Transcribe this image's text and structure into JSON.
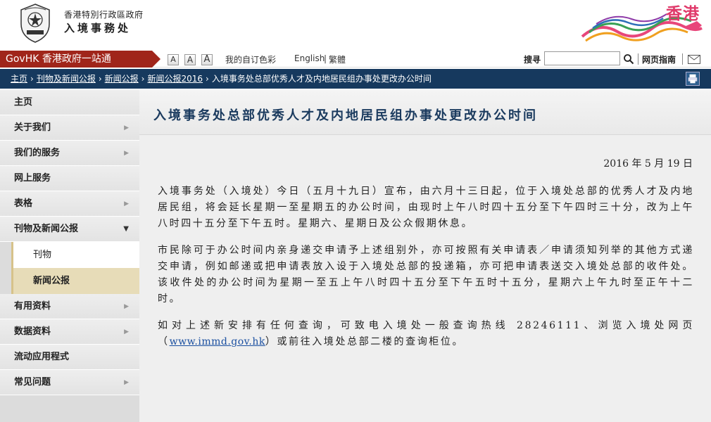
{
  "header": {
    "dept_top": "香港特別行政區政府",
    "dept_name": "入境事務处",
    "brand": "香港"
  },
  "topbar": {
    "govhk": "GovHK 香港政府一站通",
    "font_small": "A",
    "font_medium": "A",
    "font_large": "A",
    "my_theme": "我的自订色彩",
    "lang_en": "English",
    "lang_sep": "|",
    "lang_tc": "繁體",
    "search_label": "搜寻",
    "search_value": "",
    "sitemap": "网页指南"
  },
  "breadcrumb": {
    "items": [
      "主页",
      "刊物及新闻公报",
      "新闻公报",
      "新闻公报2016"
    ],
    "separator": "›",
    "current": "入境事务处总部优秀人才及内地居民组办事处更改办公时间"
  },
  "sidebar": {
    "items": [
      {
        "label": "主页",
        "arrow": ""
      },
      {
        "label": "关于我们",
        "arrow": "▶"
      },
      {
        "label": "我们的服务",
        "arrow": "▶"
      },
      {
        "label": "网上服务",
        "arrow": ""
      },
      {
        "label": "表格",
        "arrow": "▶"
      },
      {
        "label": "刊物及新闻公报",
        "arrow": "▼"
      }
    ],
    "sub_items": [
      {
        "label": "刊物"
      },
      {
        "label": "新闻公报"
      }
    ],
    "items_after": [
      {
        "label": "有用资料",
        "arrow": "▶"
      },
      {
        "label": "数据资料",
        "arrow": "▶"
      },
      {
        "label": "流动应用程式",
        "arrow": ""
      },
      {
        "label": "常见问题",
        "arrow": "▶"
      }
    ]
  },
  "main": {
    "title": "入境事务处总部优秀人才及内地居民组办事处更改办公时间",
    "date": "2016 年 5 月 19 日",
    "para1": "入境事务处（入境处）今日（五月十九日）宣布，由六月十三日起，位于入境处总部的优秀人才及内地居民组，将会延长星期一至星期五的办公时间，由现时上午八时四十五分至下午四时三十分，改为上午八时四十五分至下午五时。星期六、星期日及公众假期休息。",
    "para2": "市民除可于办公时间内亲身递交申请予上述组别外，亦可按照有关申请表／申请须知列举的其他方式递交申请，例如邮递或把申请表放入设于入境处总部的投递箱，亦可把申请表送交入境处总部的收件处。该收件处的办公时间为星期一至五上午八时四十五分至下午五时十五分，星期六上午九时至正午十二时。",
    "para3_a": "如对上述新安排有任何查询，可致电入境处一般查询热线 28246111、浏览入境处网页（",
    "para3_link": "www.immd.gov.hk",
    "para3_b": "）或前往入境处总部二楼的查询柜位。"
  },
  "colors": {
    "govhk_red": "#a0251a",
    "breadcrumb_navy": "#16395e",
    "title_navy": "#1a3a5e",
    "brand_pink": "#e03a6b",
    "active_gold": "#e7dcb8"
  }
}
